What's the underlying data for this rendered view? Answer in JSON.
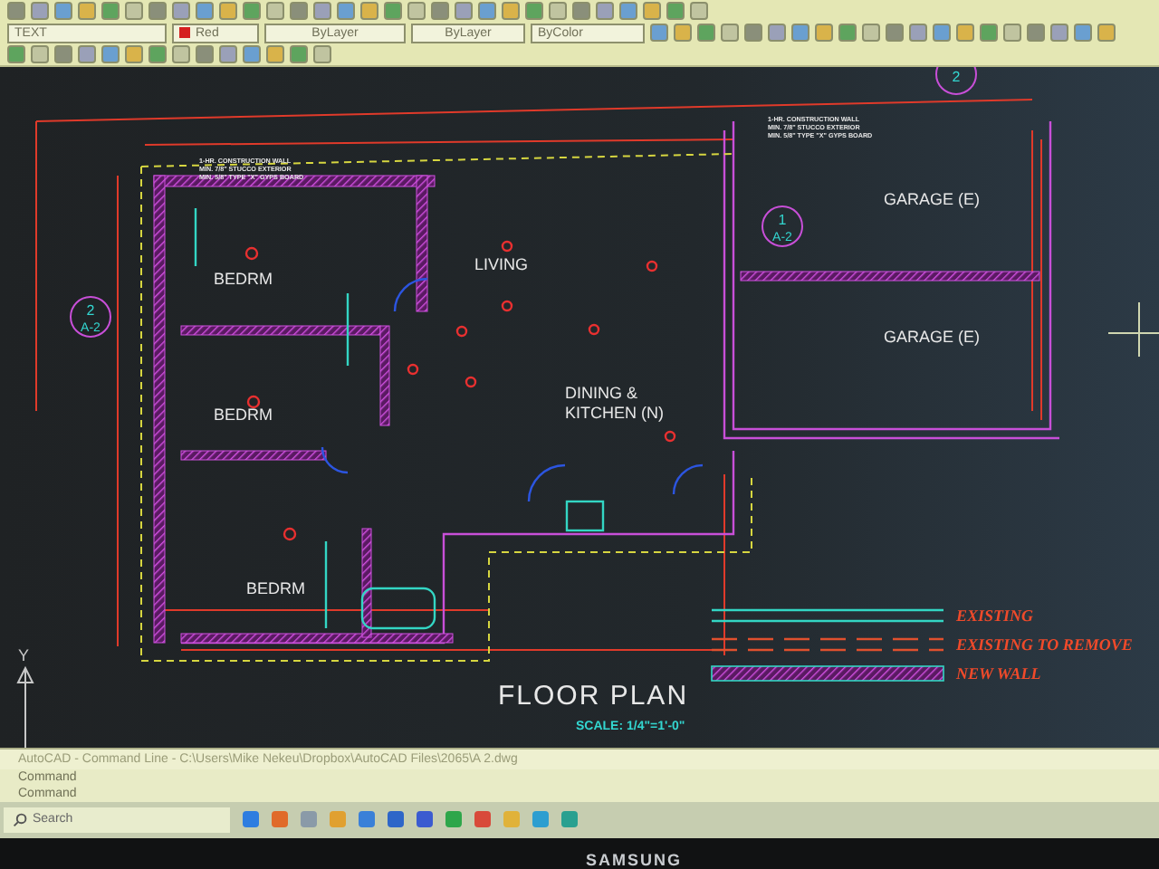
{
  "toolbar": {
    "layer": "TEXT",
    "color_setting": "Red",
    "linetype": "ByLayer",
    "lineweight": "ByLayer",
    "plot_style": "ByColor"
  },
  "plan": {
    "title": "FLOOR PLAN",
    "scale": "SCALE: 1/4\"=1'-0\"",
    "rooms": [
      "BEDRM",
      "BEDRM",
      "BEDRM",
      "LIVING",
      "DINING &",
      "KITCHEN (N)",
      "GARAGE (E)",
      "GARAGE (E)"
    ],
    "wall_notes": [
      [
        "1-HR. CONSTRUCTION WALL",
        "MIN. 7/8\" STUCCO EXTERIOR",
        "MIN. 5/8\" TYPE \"X\" GYPS BOARD"
      ],
      [
        "1-HR. CONSTRUCTION WALL",
        "MIN. 7/8\" STUCCO EXTERIOR",
        "MIN. 5/8\" TYPE \"X\" GYPS BOARD"
      ]
    ],
    "section_markers": [
      {
        "number": "2",
        "sheet": "A-2"
      },
      {
        "number": "1",
        "sheet": "A-2"
      },
      {
        "number": "2"
      }
    ],
    "axis_label": "Y"
  },
  "legend": [
    {
      "kind": "existing",
      "label": "EXISTING"
    },
    {
      "kind": "remove",
      "label": "EXISTING TO REMOVE"
    },
    {
      "kind": "new",
      "label": "NEW WALL"
    }
  ],
  "command_window": {
    "title": "AutoCAD - Command Line - C:\\Users\\Mike Nekeu\\Dropbox\\AutoCAD Files\\2065\\A 2.dwg",
    "lines": [
      "Command",
      "Command"
    ]
  },
  "taskbar": {
    "search": {
      "placeholder": "Search"
    }
  },
  "monitor": {
    "brand": "SAMSUNG"
  }
}
